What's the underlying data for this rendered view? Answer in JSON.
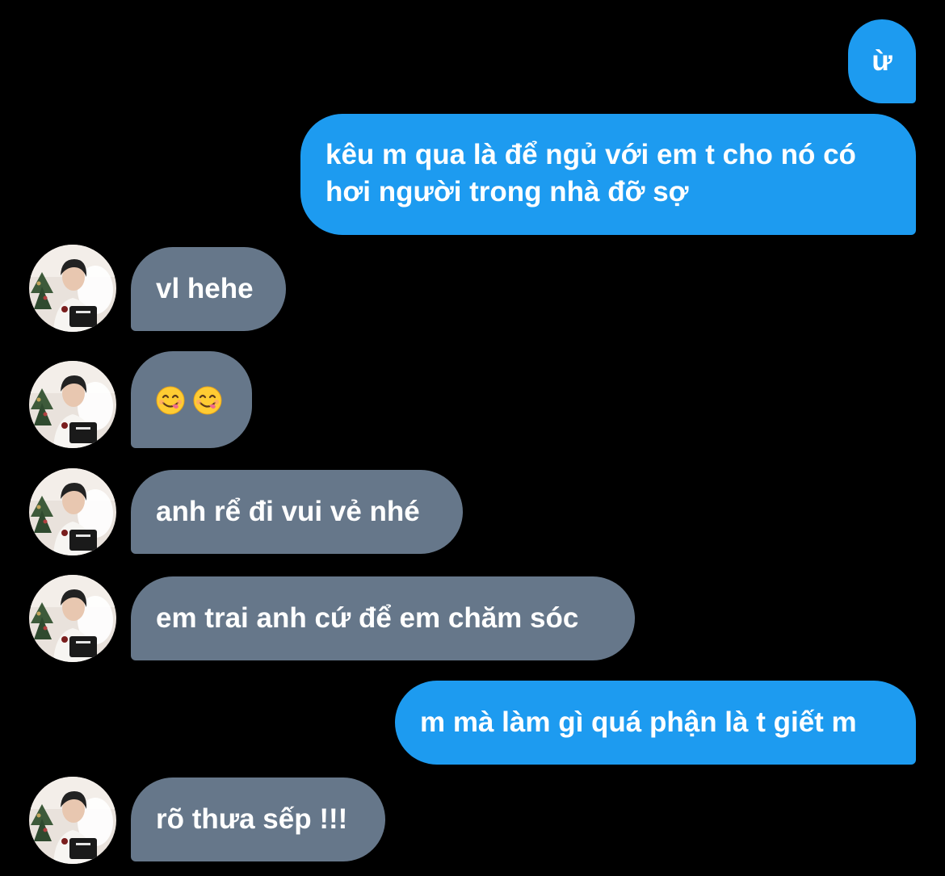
{
  "colors": {
    "background": "#000000",
    "sent_bubble": "#1d9bf0",
    "received_bubble": "#66778a",
    "text": "#ffffff"
  },
  "messages": [
    {
      "side": "sent",
      "text": "ừ"
    },
    {
      "side": "sent",
      "lines": [
        "kêu m qua là để ngủ với em t cho nó có",
        "hơi người trong nhà đỡ sợ"
      ]
    },
    {
      "side": "received",
      "text": "vl hehe"
    },
    {
      "side": "received",
      "emoji": [
        "face-savoring-food-icon",
        "face-savoring-food-icon"
      ]
    },
    {
      "side": "received",
      "text": "anh rể đi vui vẻ nhé"
    },
    {
      "side": "received",
      "text": "em trai anh cứ để em chăm sóc"
    },
    {
      "side": "sent",
      "text": "m mà làm gì quá phận là t giết m"
    },
    {
      "side": "received",
      "text": "rõ thưa sếp !!!"
    }
  ]
}
